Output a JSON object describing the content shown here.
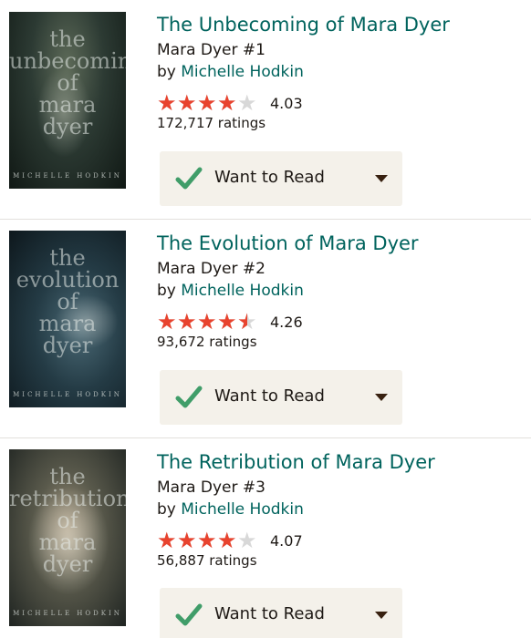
{
  "books": [
    {
      "title": "The Unbecoming of Mara Dyer",
      "series": "Mara Dyer #1",
      "by_prefix": "by",
      "author": "Michelle Hodkin",
      "avg_rating": "4.03",
      "rating_value": 4.03,
      "ratings_count": "172,717 ratings",
      "cover_title": "the\nunbecoming\nof\nmara\ndyer",
      "cover_author": "MICHELLE HODKIN",
      "shelf_label": "Want to Read"
    },
    {
      "title": "The Evolution of Mara Dyer",
      "series": "Mara Dyer #2",
      "by_prefix": "by",
      "author": "Michelle Hodkin",
      "avg_rating": "4.26",
      "rating_value": 4.26,
      "ratings_count": "93,672 ratings",
      "cover_title": "the\nevolution\nof\nmara\ndyer",
      "cover_author": "MICHELLE HODKIN",
      "shelf_label": "Want to Read"
    },
    {
      "title": "The Retribution of Mara Dyer",
      "series": "Mara Dyer #3",
      "by_prefix": "by",
      "author": "Michelle Hodkin",
      "avg_rating": "4.07",
      "rating_value": 4.07,
      "ratings_count": "56,887 ratings",
      "cover_title": "the\nretribution\nof\nmara\ndyer",
      "cover_author": "MICHELLE HODKIN",
      "shelf_label": "Want to Read"
    }
  ],
  "colors": {
    "title": "#00635d",
    "star_filled": "#e8432e",
    "star_empty": "#d8d8d8",
    "button_bg": "#f4f1ea",
    "check": "#409d69"
  },
  "icons": {
    "star": "star-icon",
    "check": "check-icon",
    "caret": "caret-down-icon"
  }
}
